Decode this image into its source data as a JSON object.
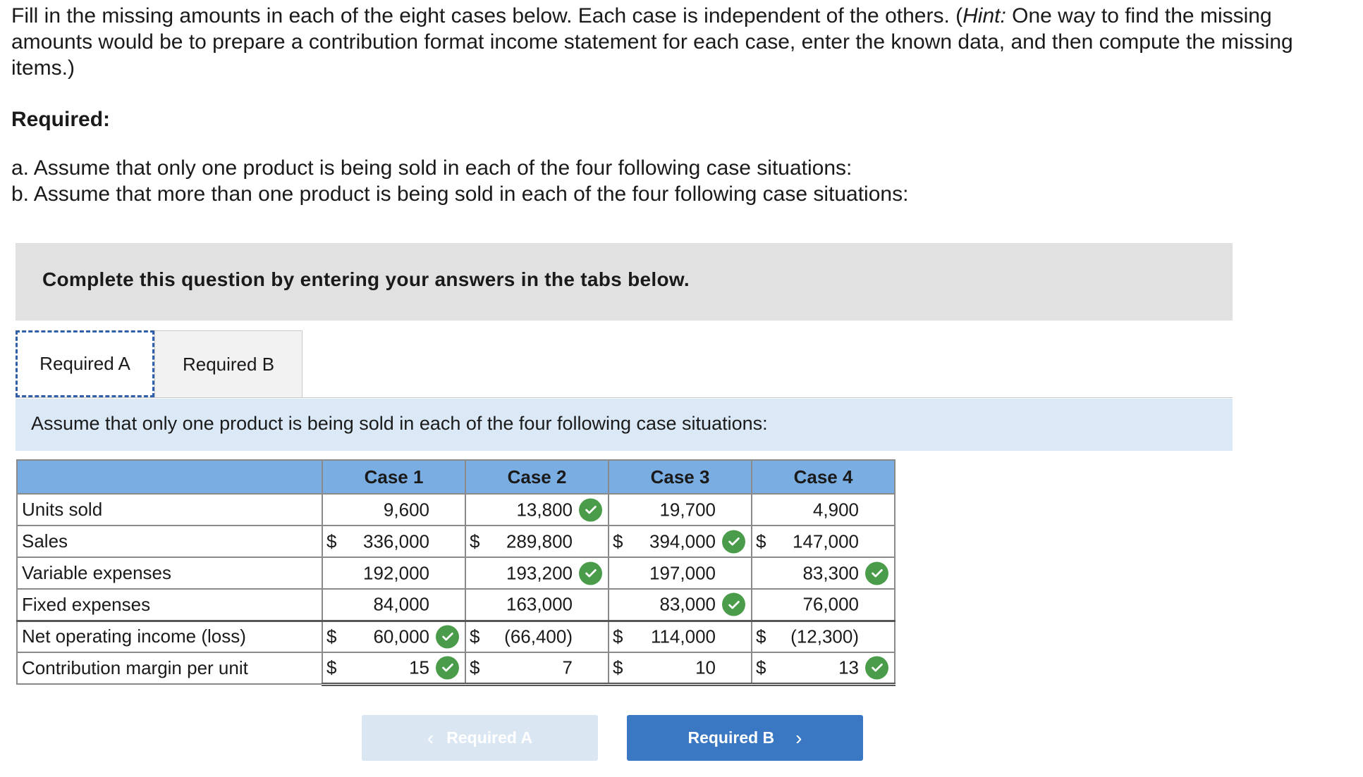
{
  "intro": {
    "text_before_hint": "Fill in the missing amounts in each of the eight cases below. Each case is independent of the others. (",
    "hint_label": "Hint:",
    "text_after_hint": " One way to find the missing amounts would be to prepare a contribution format income statement for each case, enter the known data, and then compute the missing items.)"
  },
  "required_heading": "Required:",
  "required_items": [
    "a. Assume that only one product is being sold in each of the four following case situations:",
    "b. Assume that more than one product is being sold in each of the four following case situations:"
  ],
  "banner": "Complete this question by entering your answers in the tabs below.",
  "tabs": [
    {
      "label": "Required A",
      "active": true
    },
    {
      "label": "Required B",
      "active": false
    }
  ],
  "instruction": "Assume that only one product is being sold in each of the four following case situations:",
  "table": {
    "headers": [
      "",
      "Case 1",
      "Case 2",
      "Case 3",
      "Case 4"
    ],
    "rows": [
      {
        "label": "Units sold",
        "cells": [
          {
            "cur": "",
            "val": "9,600",
            "check": false
          },
          {
            "cur": "",
            "val": "13,800",
            "check": true
          },
          {
            "cur": "",
            "val": "19,700",
            "check": false
          },
          {
            "cur": "",
            "val": "4,900",
            "check": false
          }
        ]
      },
      {
        "label": "Sales",
        "cells": [
          {
            "cur": "$",
            "val": "336,000",
            "check": false
          },
          {
            "cur": "$",
            "val": "289,800",
            "check": false
          },
          {
            "cur": "$",
            "val": "394,000",
            "check": true
          },
          {
            "cur": "$",
            "val": "147,000",
            "check": false
          }
        ]
      },
      {
        "label": "Variable expenses",
        "cells": [
          {
            "cur": "",
            "val": "192,000",
            "check": false
          },
          {
            "cur": "",
            "val": "193,200",
            "check": true
          },
          {
            "cur": "",
            "val": "197,000",
            "check": false
          },
          {
            "cur": "",
            "val": "83,300",
            "check": true
          }
        ]
      },
      {
        "label": "Fixed expenses",
        "cells": [
          {
            "cur": "",
            "val": "84,000",
            "check": false
          },
          {
            "cur": "",
            "val": "163,000",
            "check": false
          },
          {
            "cur": "",
            "val": "83,000",
            "check": true
          },
          {
            "cur": "",
            "val": "76,000",
            "check": false
          }
        ]
      },
      {
        "label": "Net operating income (loss)",
        "cells": [
          {
            "cur": "$",
            "val": "60,000",
            "check": true
          },
          {
            "cur": "$",
            "val": "(66,400)",
            "check": false
          },
          {
            "cur": "$",
            "val": "114,000",
            "check": false
          },
          {
            "cur": "$",
            "val": "(12,300)",
            "check": false
          }
        ]
      },
      {
        "label": "Contribution margin per unit",
        "cells": [
          {
            "cur": "$",
            "val": "15",
            "check": true
          },
          {
            "cur": "$",
            "val": "7",
            "check": false
          },
          {
            "cur": "$",
            "val": "10",
            "check": false
          },
          {
            "cur": "$",
            "val": "13",
            "check": true
          }
        ]
      }
    ]
  },
  "nav": {
    "prev_label": "Required A",
    "next_label": "Required B",
    "prev_icon": "chevron-left-icon",
    "next_icon": "chevron-right-icon"
  },
  "colors": {
    "header_fill": "#7aaee3",
    "check_green": "#4a9c4a",
    "next_button": "#3a78c4",
    "prev_button_disabled": "#dbe6f3",
    "instruction_bar": "#dbe9f7",
    "banner": "#e1e1e1"
  }
}
